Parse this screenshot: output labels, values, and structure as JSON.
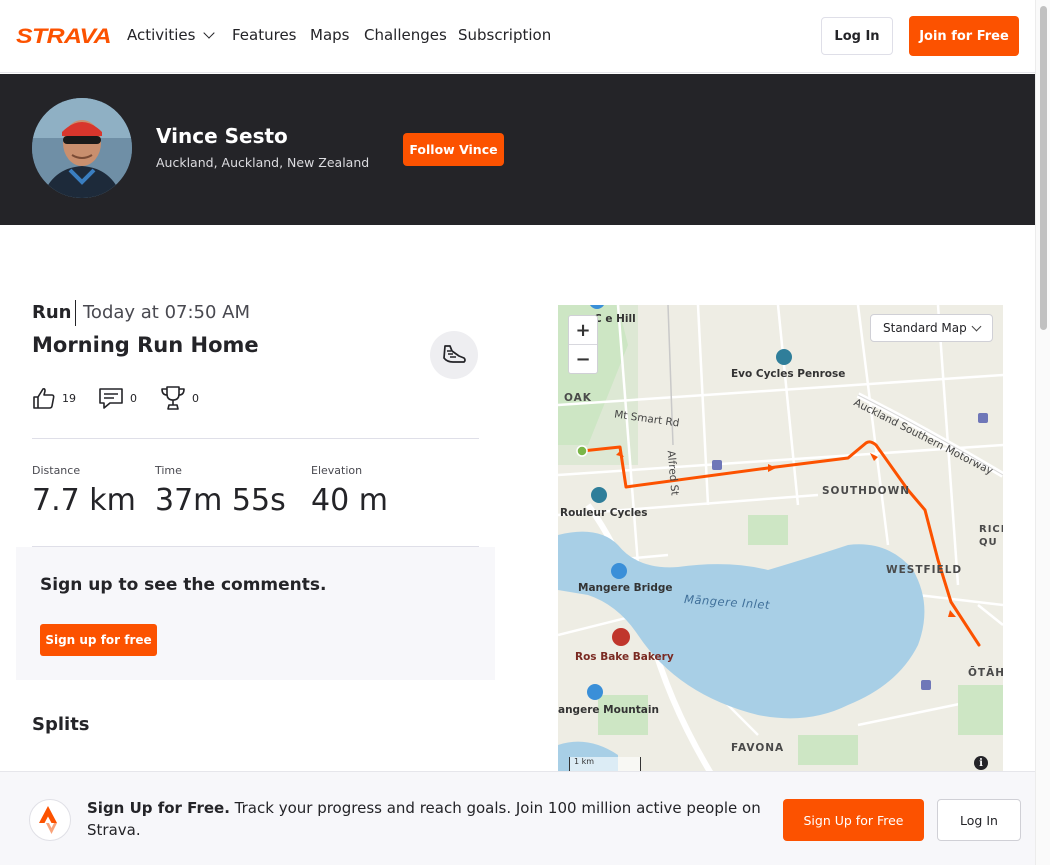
{
  "nav": {
    "logo_text": "STRAVA",
    "items": [
      "Activities",
      "Features",
      "Maps",
      "Challenges",
      "Subscription"
    ],
    "login_label": "Log In",
    "join_label": "Join for Free"
  },
  "athlete": {
    "name": "Vince Sesto",
    "location": "Auckland, Auckland, New Zealand",
    "follow_label": "Follow Vince"
  },
  "activity": {
    "type": "Run",
    "time": "Today at 07:50 AM",
    "title": "Morning Run Home",
    "kudos": "19",
    "comments": "0",
    "achievements": "0",
    "stats": [
      {
        "label": "Distance",
        "value": "7.7 km"
      },
      {
        "label": "Time",
        "value": "37m 55s"
      },
      {
        "label": "Elevation",
        "value": "40 m"
      }
    ]
  },
  "comments_box": {
    "title": "Sign up to see the comments.",
    "button_label": "Sign up for free"
  },
  "splits": {
    "title": "Splits"
  },
  "map": {
    "zoom_in": "+",
    "zoom_out": "−",
    "style_select": "Standard Map",
    "scale_label": "1 km",
    "info": "i",
    "labels": {
      "cornwall_hill": "C      e Hill",
      "evo_cycles": "Evo Cycles Penrose",
      "oak": "OAK",
      "mt_smart_rd": "Mt Smart Rd",
      "alfred_st": "Alfred St",
      "motorway": "Auckland Southern Motorway",
      "southdown": "SOUTHDOWN",
      "rouleur": "Rouleur Cycles",
      "richmond": "RICH QU",
      "westfield": "WESTFIELD",
      "mangere_bridge": "Mangere Bridge",
      "mangere_inlet": "Māngere Inlet",
      "ros_bake": "Ros Bake Bakery",
      "otahuhu": "ŌTĀH",
      "mangere_mountain": "angere Mountain",
      "favona": "FAVONA"
    },
    "colors": {
      "route": "#fc5200",
      "water": "#a8cfe6",
      "park": "#cde6c4"
    }
  },
  "banner": {
    "headline": "Sign Up for Free.",
    "body": " Track your progress and reach goals. Join 100 million active people on Strava.",
    "signup_label": "Sign Up for Free",
    "login_label": "Log In"
  },
  "brand": {
    "accent": "#fc5200",
    "dark": "#242428"
  }
}
